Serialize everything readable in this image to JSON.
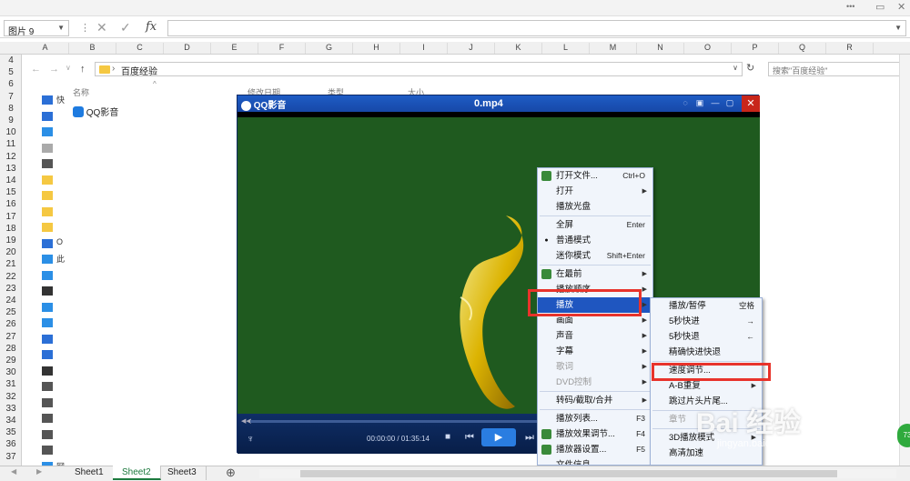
{
  "excel": {
    "name_box": "图片 9",
    "columns": [
      "A",
      "B",
      "C",
      "D",
      "E",
      "F",
      "G",
      "H",
      "I",
      "J",
      "K",
      "L",
      "M",
      "N",
      "O",
      "P",
      "Q",
      "R"
    ],
    "rows": [
      "4",
      "5",
      "6",
      "7",
      "8",
      "9",
      "10",
      "11",
      "12",
      "13",
      "14",
      "15",
      "16",
      "17",
      "18",
      "19",
      "20",
      "21",
      "22",
      "23",
      "24",
      "25",
      "26",
      "27",
      "28",
      "29",
      "30",
      "31",
      "32",
      "33",
      "34",
      "35",
      "36",
      "37"
    ],
    "sheets": [
      "Sheet1",
      "Sheet2",
      "Sheet3"
    ],
    "active_sheet": "Sheet2",
    "ribbon_dots": "•••"
  },
  "explorer": {
    "breadcrumb": "百度经验",
    "search_placeholder": "搜索\"百度经验\"",
    "columns": {
      "name": "名称",
      "modified": "修改日期",
      "type": "类型",
      "size": "大小"
    },
    "file": "QQ影音",
    "sidebar": [
      "快",
      "",
      "",
      "",
      "",
      "",
      "",
      "",
      "",
      "O",
      "此",
      "",
      "",
      "",
      "",
      "",
      "",
      "",
      "",
      "",
      "",
      "",
      "",
      "网"
    ]
  },
  "player": {
    "logo": "QQ影音",
    "filename": "0.mp4",
    "time": "00:00:00 / 01:35:14"
  },
  "menu_main": [
    {
      "label": "打开文件...",
      "shortcut": "Ctrl+O",
      "icon": "open-file-icon"
    },
    {
      "label": "打开",
      "submenu": true
    },
    {
      "label": "播放光盘"
    },
    {
      "sep": true
    },
    {
      "label": "全屏",
      "shortcut": "Enter"
    },
    {
      "label": "普通模式",
      "bullet": true
    },
    {
      "label": "迷你模式",
      "shortcut": "Shift+Enter"
    },
    {
      "sep": true
    },
    {
      "label": "在最前",
      "submenu": true,
      "icon": "pin-icon"
    },
    {
      "label": "播放顺序",
      "submenu": true
    },
    {
      "label": "播放",
      "submenu": true,
      "highlight": true
    },
    {
      "label": "画面",
      "submenu": true
    },
    {
      "label": "声音",
      "submenu": true
    },
    {
      "label": "字幕",
      "submenu": true
    },
    {
      "label": "歌词",
      "submenu": true,
      "disabled": true
    },
    {
      "label": "DVD控制",
      "submenu": true,
      "disabled": true
    },
    {
      "sep": true
    },
    {
      "label": "转码/截取/合并",
      "submenu": true
    },
    {
      "sep": true
    },
    {
      "label": "播放列表...",
      "shortcut": "F3"
    },
    {
      "label": "播放效果调节...",
      "shortcut": "F4",
      "icon": "effect-icon"
    },
    {
      "label": "播放器设置...",
      "shortcut": "F5",
      "icon": "settings-icon"
    },
    {
      "label": "文件信息..."
    }
  ],
  "menu_sub": [
    {
      "label": "播放/暂停",
      "shortcut": "空格"
    },
    {
      "label": "5秒快进",
      "shortcut": "→"
    },
    {
      "label": "5秒快退",
      "shortcut": "←"
    },
    {
      "label": "精确快进快退"
    },
    {
      "sep": true
    },
    {
      "label": "速度调节..."
    },
    {
      "label": "A-B重复",
      "submenu": true
    },
    {
      "label": "跳过片头片尾..."
    },
    {
      "sep": true
    },
    {
      "label": "章节",
      "disabled": true
    },
    {
      "sep": true
    },
    {
      "label": "3D播放模式",
      "submenu": true
    },
    {
      "label": "高清加速"
    }
  ],
  "watermark": {
    "brand": "Bai 经验",
    "url": "jingyan.baidu.com"
  },
  "badge": "73",
  "colors": {
    "highlight": "#1f56c0",
    "annotation": "#e8332b",
    "video_bg": "#1f5a1f"
  }
}
